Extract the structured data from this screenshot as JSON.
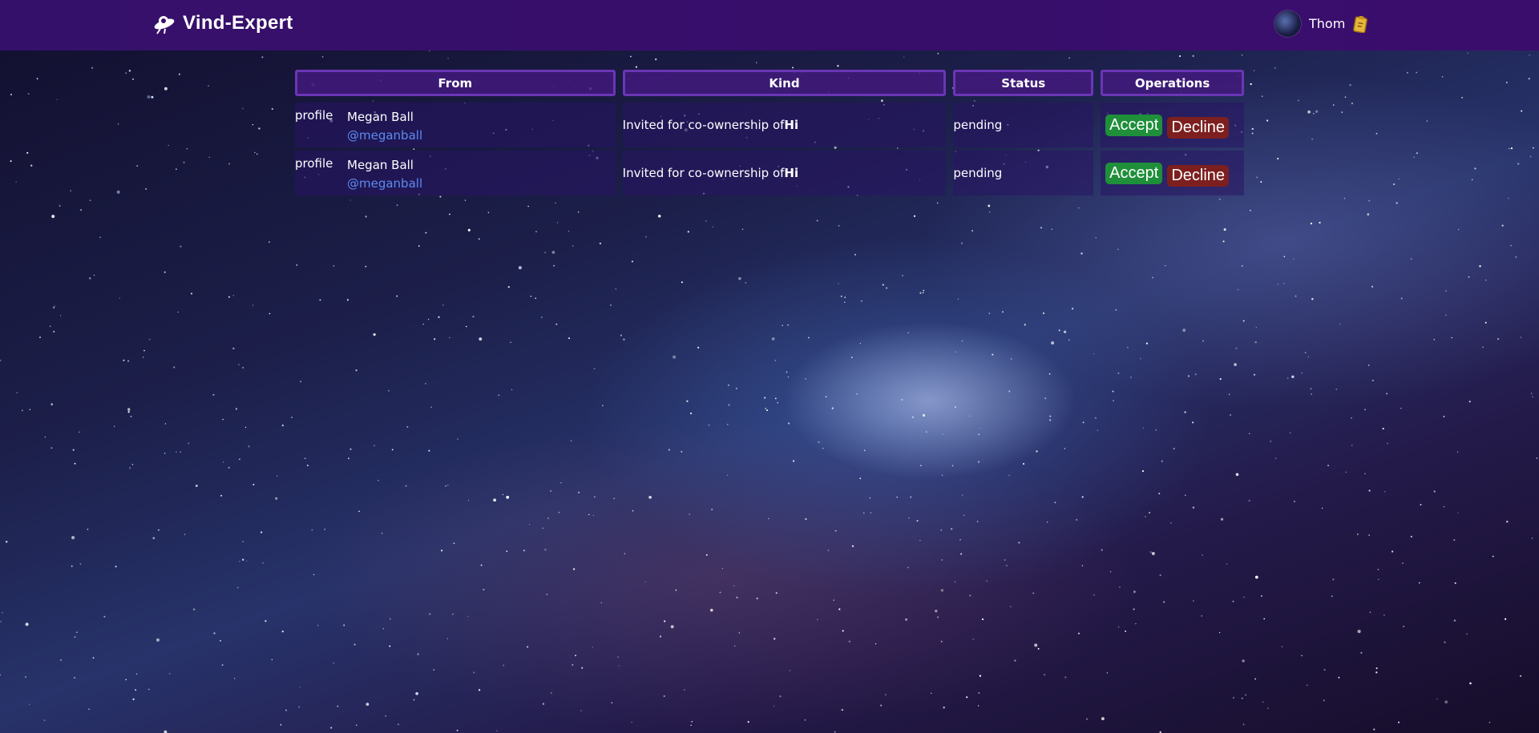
{
  "navbar": {
    "brand": "Vind-Expert",
    "brand_icon": "ufo-icon",
    "user_name": "Thom",
    "user_icon": "clipboard-icon"
  },
  "table": {
    "headers": [
      "From",
      "Kind",
      "Status",
      "Operations"
    ],
    "rows": [
      {
        "profile_label": "profile",
        "name": "Megan Ball",
        "handle": "@meganball",
        "kind_prefix": "Invited for co-ownership of",
        "kind_target": "Hi",
        "status": "pending",
        "accept_label": "Accept",
        "decline_label": "Decline"
      },
      {
        "profile_label": "profile",
        "name": "Megan Ball",
        "handle": "@meganball",
        "kind_prefix": "Invited for co-ownership of",
        "kind_target": "Hi",
        "status": "pending",
        "accept_label": "Accept",
        "decline_label": "Decline"
      }
    ]
  },
  "colors": {
    "navbar": "#3a0d6c",
    "header_border": "#6a36b5",
    "accept": "#1f8f3a",
    "decline": "#7d1f1f",
    "handle": "#5b8cf0"
  }
}
